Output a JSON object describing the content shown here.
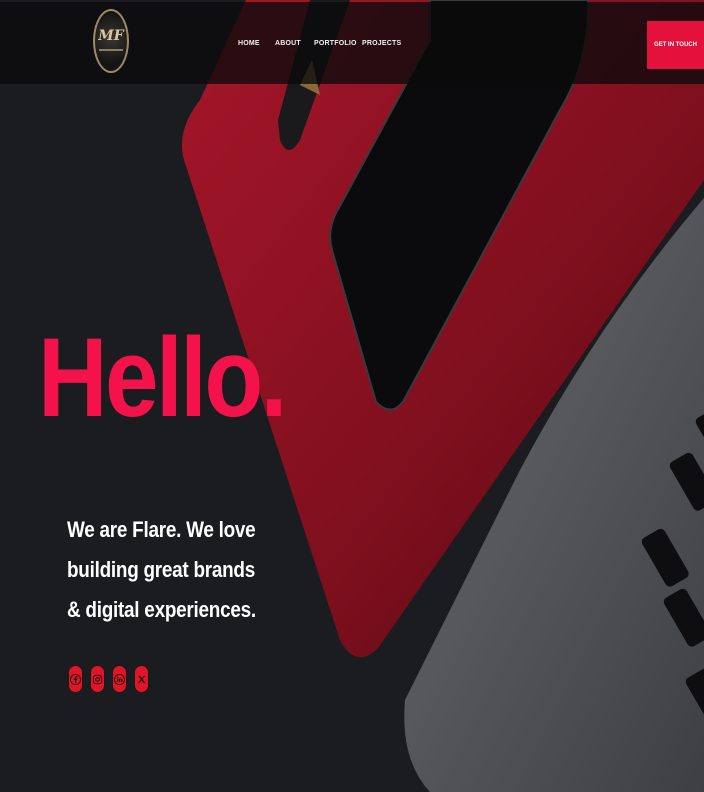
{
  "brand": {
    "logo_text": "MF"
  },
  "nav": {
    "items": [
      {
        "label": "HOME"
      },
      {
        "label": "ABOUT"
      },
      {
        "label": "PORTFOLIO"
      },
      {
        "label": "PROJECTS"
      }
    ],
    "cta_label": "GET IN TOUCH"
  },
  "hero": {
    "headline": "Hello.",
    "tagline_lines": [
      "We are Flare. We love",
      "building great brands",
      "& digital experiences."
    ]
  },
  "social": [
    {
      "icon": "facebook-icon"
    },
    {
      "icon": "instagram-icon"
    },
    {
      "icon": "linkedin-icon"
    },
    {
      "icon": "x-icon"
    }
  ],
  "colors": {
    "accent": "#e3113b",
    "headline": "#f3134a",
    "background": "#1b1c20",
    "notebook": "#8c1020"
  }
}
